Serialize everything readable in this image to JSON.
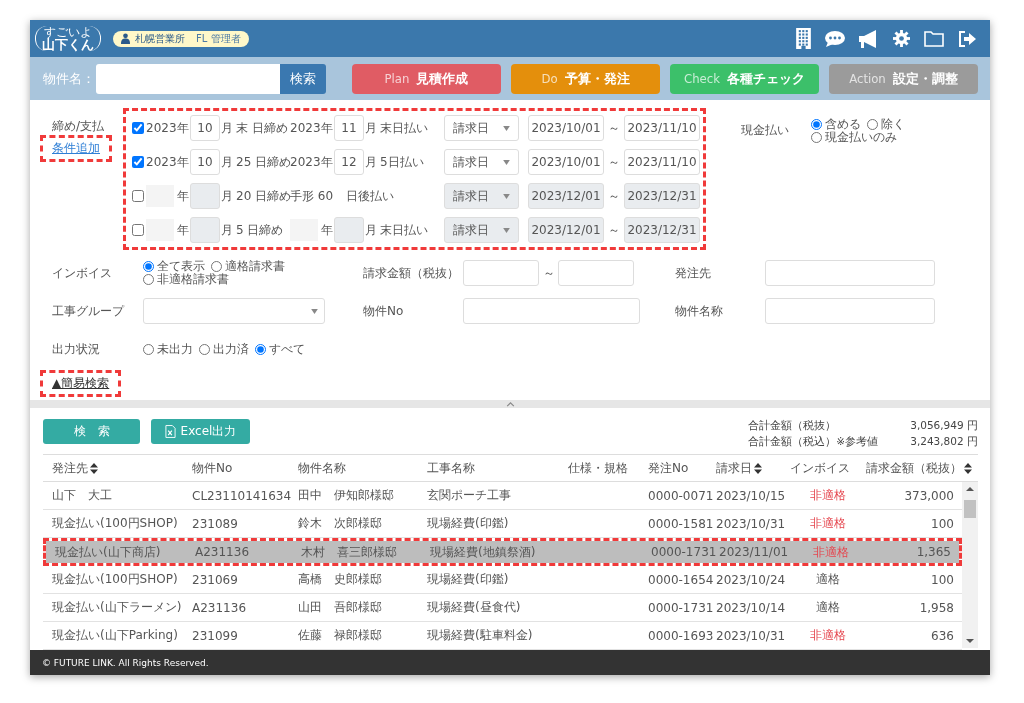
{
  "header": {
    "logo": [
      "すごいよ",
      "山下くん"
    ],
    "office": "札幌営業所",
    "role": "FL 管理者"
  },
  "nav": {
    "name_label": "物件名：",
    "search_button": "検索",
    "phases": [
      {
        "word": "Plan",
        "label": "見積作成",
        "color": "#e05c64"
      },
      {
        "word": "Do",
        "label": "予算・発注",
        "color": "#e48f0c"
      },
      {
        "word": "Check",
        "label": "各種チェック",
        "color": "#3cc06a"
      },
      {
        "word": "Action",
        "label": "設定・調整",
        "color": "#9b9b9b"
      }
    ]
  },
  "conditions": {
    "label": "締め/支払",
    "add_link": {
      "text": "条件追加",
      "highlighted": true
    },
    "highlighted": true,
    "rows": [
      {
        "kind": "month",
        "checked": true,
        "disabled": false,
        "year": "2023",
        "year_unit": "年",
        "month": "10",
        "month_unit": "月",
        "closing": "末 日締め",
        "pay_year": "2023",
        "pay_year_unit": "年",
        "pay_month": "11",
        "pay_month_unit": "月",
        "payment": "末日払い",
        "basis": "請求日",
        "from": "2023/10/01",
        "range_sep": "～",
        "to": "2023/11/10"
      },
      {
        "kind": "month",
        "checked": true,
        "disabled": false,
        "year": "2023",
        "year_unit": "年",
        "month": "10",
        "month_unit": "月",
        "closing": "25 日締め",
        "pay_year": "2023",
        "pay_year_unit": "年",
        "pay_month": "12",
        "pay_month_unit": "月",
        "payment": "5日払い",
        "basis": "請求日",
        "from": "2023/10/01",
        "range_sep": "～",
        "to": "2023/11/10"
      },
      {
        "kind": "note",
        "checked": false,
        "disabled": true,
        "year_unit": "年",
        "month_unit": "月",
        "closing": "20 日締め",
        "note": "手形 60",
        "payment": "日後払い",
        "basis": "請求日",
        "from": "2023/12/01",
        "range_sep": "～",
        "to": "2023/12/31"
      },
      {
        "kind": "month",
        "checked": false,
        "disabled": true,
        "year_unit": "年",
        "month_unit": "月",
        "closing": "5 日締め",
        "pay_year_unit": "年",
        "pay_month_unit": "月",
        "payment": "末日払い",
        "basis": "請求日",
        "from": "2023/12/01",
        "range_sep": "～",
        "to": "2023/12/31"
      }
    ]
  },
  "cash_payment": {
    "label": "現金払い",
    "options": [
      {
        "label": "含める",
        "selected": true
      },
      {
        "label": "除く",
        "selected": false
      },
      {
        "label": "現金払いのみ",
        "selected": false
      }
    ]
  },
  "invoice": {
    "label": "インボイス",
    "options": [
      {
        "label": "全て表示",
        "selected": true
      },
      {
        "label": "適格請求書",
        "selected": false
      },
      {
        "label": "非適格請求書",
        "selected": false
      }
    ]
  },
  "amount": {
    "label": "請求金額（税抜）",
    "range_sep": "～"
  },
  "supplier": {
    "label": "発注先"
  },
  "group": {
    "label": "工事グループ"
  },
  "property_no": {
    "label": "物件No"
  },
  "property_name": {
    "label": "物件名称"
  },
  "output_status": {
    "label": "出力状況",
    "options": [
      {
        "label": "未出力",
        "selected": false
      },
      {
        "label": "出力済",
        "selected": false
      },
      {
        "label": "すべて",
        "selected": true
      }
    ]
  },
  "simple_search": {
    "text": "▲簡易検索",
    "highlighted": true
  },
  "actions": {
    "search_button": "検　索",
    "excel_button": "Excel出力"
  },
  "totals": [
    {
      "label": "合計金額（税抜）",
      "value": "3,056,949 円"
    },
    {
      "label": "合計金額（税込）※参考値",
      "value": "3,243,802 円"
    }
  ],
  "table": {
    "columns": [
      {
        "label": "発注先",
        "sortable": true
      },
      {
        "label": "物件No",
        "sortable": false
      },
      {
        "label": "物件名称",
        "sortable": false
      },
      {
        "label": "工事名称",
        "sortable": false
      },
      {
        "label": "仕様・規格",
        "sortable": false
      },
      {
        "label": "発注No",
        "sortable": false
      },
      {
        "label": "請求日",
        "sortable": true
      },
      {
        "label": "インボイス",
        "sortable": false
      },
      {
        "label": "請求金額（税抜）",
        "sortable": true
      }
    ],
    "rows": [
      {
        "supplier": "山下　大工",
        "property_no": "CL23110141634",
        "property_name": "田中　伊知郎様邸",
        "work_name": "玄関ポーチ工事",
        "order_no": "0000-0071",
        "billing_date": "2023/10/15",
        "invoice": "非適格",
        "invoice_eligible": false,
        "amount": "373,000",
        "selected": false,
        "highlighted": false
      },
      {
        "supplier": "現金払い(100円SHOP)",
        "property_no": "231089",
        "property_name": "鈴木　次郎様邸",
        "work_name": "現場経費(印鑑)",
        "order_no": "0000-1581",
        "billing_date": "2023/10/31",
        "invoice": "非適格",
        "invoice_eligible": false,
        "amount": "100",
        "selected": false,
        "highlighted": false
      },
      {
        "supplier": "現金払い(山下商店)",
        "property_no": "A231136",
        "property_name": "木村　喜三郎様邸",
        "work_name": "現場経費(地鎮祭酒)",
        "order_no": "0000-1731",
        "billing_date": "2023/11/01",
        "invoice": "非適格",
        "invoice_eligible": false,
        "amount": "1,365",
        "selected": true,
        "highlighted": true
      },
      {
        "supplier": "現金払い(100円SHOP)",
        "property_no": "231069",
        "property_name": "高橋　史郎様邸",
        "work_name": "現場経費(印鑑)",
        "order_no": "0000-1654",
        "billing_date": "2023/10/24",
        "invoice": "適格",
        "invoice_eligible": true,
        "amount": "100",
        "selected": false,
        "highlighted": false
      },
      {
        "supplier": "現金払い(山下ラーメン)",
        "property_no": "A231136",
        "property_name": "山田　吾郎様邸",
        "work_name": "現場経費(昼食代)",
        "order_no": "0000-1731",
        "billing_date": "2023/10/14",
        "invoice": "適格",
        "invoice_eligible": true,
        "amount": "1,958",
        "selected": false,
        "highlighted": false
      },
      {
        "supplier": "現金払い(山下Parking)",
        "property_no": "231099",
        "property_name": "佐藤　禄郎様邸",
        "work_name": "現場経費(駐車料金)",
        "order_no": "0000-1693",
        "billing_date": "2023/10/31",
        "invoice": "非適格",
        "invoice_eligible": false,
        "amount": "636",
        "selected": false,
        "highlighted": false
      }
    ]
  },
  "footer": {
    "copyright": "© FUTURE LINK. All Rights Reserved."
  }
}
